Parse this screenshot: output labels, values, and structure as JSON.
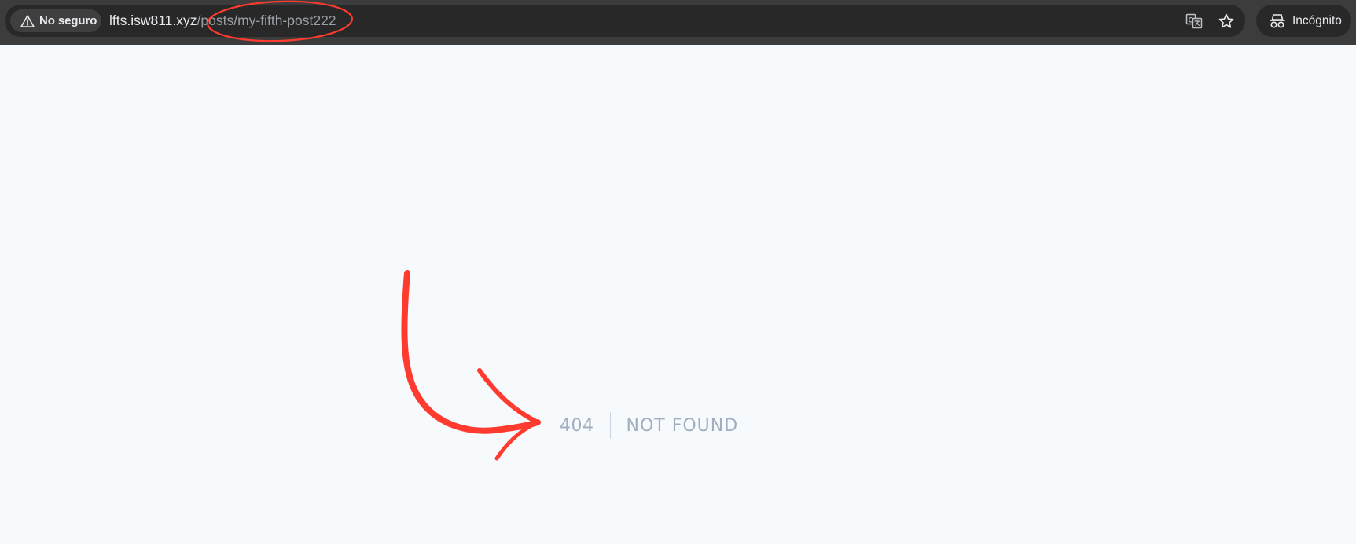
{
  "browser": {
    "security_label": "No seguro",
    "url_host": "lfts.isw811.xyz",
    "url_path": "/posts/my-fifth-post222",
    "profile_label": "Incógnito",
    "icons": {
      "security": "warning-triangle-icon",
      "translate": "translate-icon",
      "bookmark": "star-icon",
      "profile": "incognito-icon"
    }
  },
  "page": {
    "error_code": "404",
    "error_message": "Not Found",
    "text_color": "#a0aec0",
    "background": "#f7fafc"
  },
  "annotation": {
    "color": "#ff3b30",
    "marks": [
      "circle-around-url-path",
      "curved-arrow-pointing-to-error"
    ]
  }
}
